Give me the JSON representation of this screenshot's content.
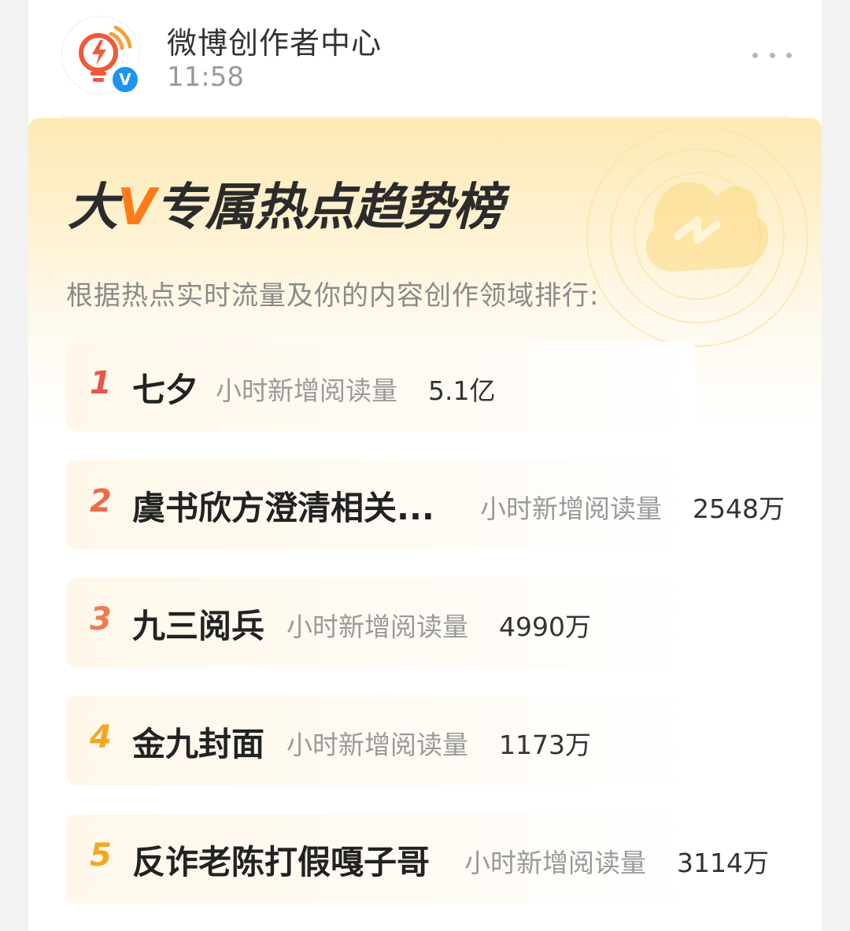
{
  "header": {
    "account_name": "微博创作者中心",
    "post_time": "11:58",
    "verified_badge": "V",
    "avatar_icon": "lightbulb-lightning-icon",
    "more_icon": "more-dots-icon"
  },
  "banner": {
    "title_prefix": "大",
    "title_v": "V",
    "title_suffix": "专属热点趋势榜",
    "subtitle": "根据热点实时流量及你的内容创作领域排行:",
    "deco_icon": "weibo-coin-icon"
  },
  "colors": {
    "rank_1": "#e8574a",
    "rank_2": "#ec6a4d",
    "rank_3": "#ee7c4e",
    "rank_4": "#f4a623",
    "rank_5": "#f4a623",
    "accent": "#ff7a1a"
  },
  "ranking": [
    {
      "rank": "1",
      "topic": "七夕",
      "label": "小时新增阅读量",
      "value": "5.1亿"
    },
    {
      "rank": "2",
      "topic": "虞书欣方澄清相关...",
      "label": "小时新增阅读量",
      "value": "2548万"
    },
    {
      "rank": "3",
      "topic": "九三阅兵",
      "label": "小时新增阅读量",
      "value": "4990万"
    },
    {
      "rank": "4",
      "topic": "金九封面",
      "label": "小时新增阅读量",
      "value": "1173万"
    },
    {
      "rank": "5",
      "topic": "反诈老陈打假嘎子哥",
      "label": "小时新增阅读量",
      "value": "3114万"
    }
  ]
}
